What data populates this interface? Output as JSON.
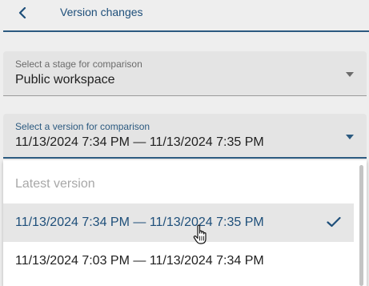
{
  "header": {
    "title": "Version changes",
    "back_icon": "chevron-left-icon"
  },
  "stage_field": {
    "label": "Select a stage for comparison",
    "value": "Public workspace"
  },
  "version_field": {
    "label": "Select a version for comparison",
    "value": "11/13/2024 7:34 PM — 11/13/2024 7:35 PM"
  },
  "dropdown": {
    "options": [
      {
        "label": "Latest version",
        "disabled": true
      },
      {
        "label": "11/13/2024 7:34 PM — 11/13/2024 7:35 PM",
        "selected": true
      },
      {
        "label": "11/13/2024 7:03 PM — 11/13/2024 7:34 PM"
      }
    ],
    "check_icon": "check-icon"
  },
  "colors": {
    "accent": "#2c5a80",
    "title": "#1e4f7a",
    "field_bg": "#e4e4e4",
    "selected_bg": "#e6e6e6"
  }
}
